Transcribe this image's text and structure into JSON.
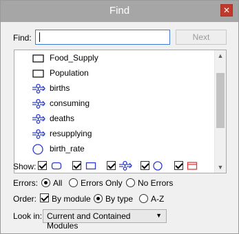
{
  "window": {
    "title": "Find",
    "close_icon": "close-icon"
  },
  "search": {
    "label": "Find:",
    "value": "",
    "next_label": "Next"
  },
  "results": [
    {
      "label": "Food_Supply",
      "icon": "stock-icon"
    },
    {
      "label": "Population",
      "icon": "stock-icon"
    },
    {
      "label": "births",
      "icon": "flow-icon"
    },
    {
      "label": "consuming",
      "icon": "flow-icon"
    },
    {
      "label": "deaths",
      "icon": "flow-icon"
    },
    {
      "label": "resupplying",
      "icon": "flow-icon"
    },
    {
      "label": "birth_rate",
      "icon": "converter-icon"
    }
  ],
  "show": {
    "label": "Show:",
    "filters": [
      {
        "icon": "rounded-rect-icon",
        "checked": true
      },
      {
        "icon": "stock-icon",
        "checked": true
      },
      {
        "icon": "flow-icon",
        "checked": true
      },
      {
        "icon": "converter-icon",
        "checked": true
      },
      {
        "icon": "module-icon",
        "checked": true
      }
    ]
  },
  "errors": {
    "label": "Errors:",
    "options": [
      "All",
      "Errors Only",
      "No Errors"
    ],
    "selected": "All"
  },
  "order": {
    "label": "Order:",
    "by_module_label": "By module",
    "by_module_checked": true,
    "options": [
      "By type",
      "A-Z"
    ],
    "selected": "By type"
  },
  "look_in": {
    "label": "Look in:",
    "value": "Current and Contained Modules"
  },
  "colors": {
    "icon_blue": "#2b3bd1",
    "module_red": "#e03c3c",
    "titlebar": "#a6a6a6",
    "close": "#c0392b"
  }
}
